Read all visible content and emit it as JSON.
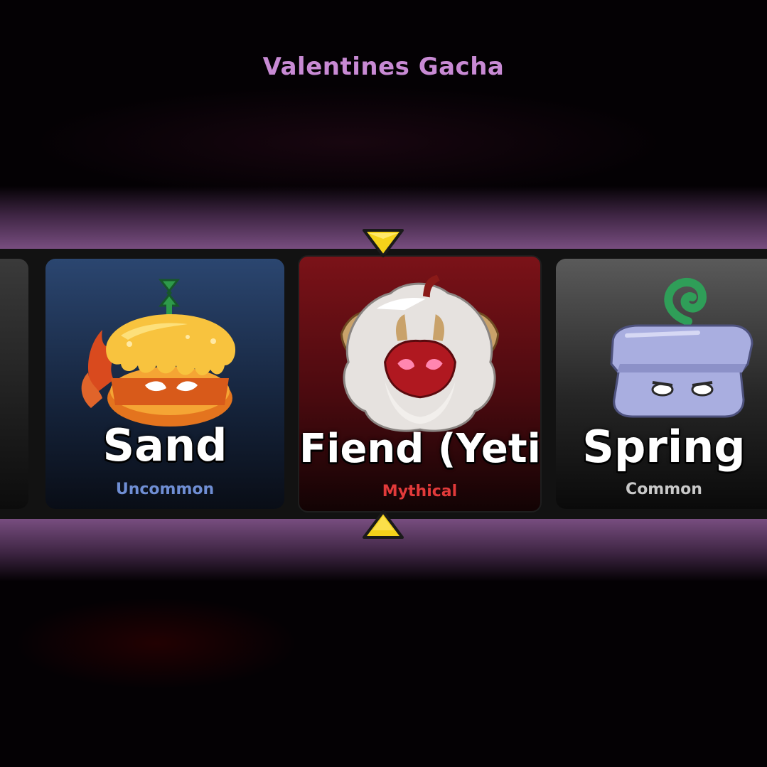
{
  "title": "Valentines Gacha",
  "colors": {
    "title": "#c88ad4",
    "band": "#7a4f82",
    "pointer": "#f4d21a",
    "uncommon": "#6f8ed4",
    "mythical": "#e23a3a",
    "common": "#c9c9c9"
  },
  "carousel": {
    "selected_index": 1,
    "items": [
      {
        "name": "Sand",
        "rarity": "Uncommon",
        "icon": "sand-fruit-icon"
      },
      {
        "name": "Fiend (Yeti)",
        "rarity": "Mythical",
        "icon": "fiend-yeti-fruit-icon"
      },
      {
        "name": "Spring",
        "rarity": "Common",
        "icon": "spring-fruit-icon"
      }
    ]
  },
  "pointers": {
    "top": "down-arrow-pointer-icon",
    "bottom": "up-arrow-pointer-icon"
  }
}
